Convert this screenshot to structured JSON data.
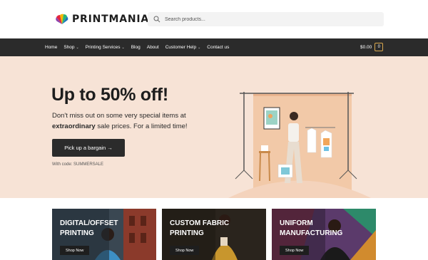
{
  "brand": {
    "name": "PRINTMANIA"
  },
  "search": {
    "placeholder": "Search products..."
  },
  "nav": {
    "items": [
      {
        "label": "Home",
        "dropdown": false
      },
      {
        "label": "Shop",
        "dropdown": true
      },
      {
        "label": "Printing Services",
        "dropdown": true
      },
      {
        "label": "Blog",
        "dropdown": false
      },
      {
        "label": "About",
        "dropdown": false
      },
      {
        "label": "Customer Help",
        "dropdown": true
      },
      {
        "label": "Contact us",
        "dropdown": false
      }
    ],
    "cart_total": "$0.00",
    "cart_count": "0"
  },
  "hero": {
    "title": "Up to 50% off!",
    "text_before": "Don't miss out on some very special items at ",
    "text_bold": "extraordinary",
    "text_after": " sale prices. For a limited time!",
    "button_label": "Pick up a bargain →",
    "code_text": "With code: SUMMERSALE"
  },
  "cards": [
    {
      "title": "DIGITAL/OFFSET PRINTING",
      "button": "Shop Now"
    },
    {
      "title": "CUSTOM FABRIC PRINTING",
      "button": "Shop Now"
    },
    {
      "title": "UNIFORM MANUFACTURING",
      "button": "Shop Now"
    }
  ],
  "colors": {
    "nav_bg": "#2b2b2b",
    "hero_bg": "#f7e3d6",
    "button_bg": "#2b2b2b",
    "cart_accent": "#d9a84e"
  }
}
